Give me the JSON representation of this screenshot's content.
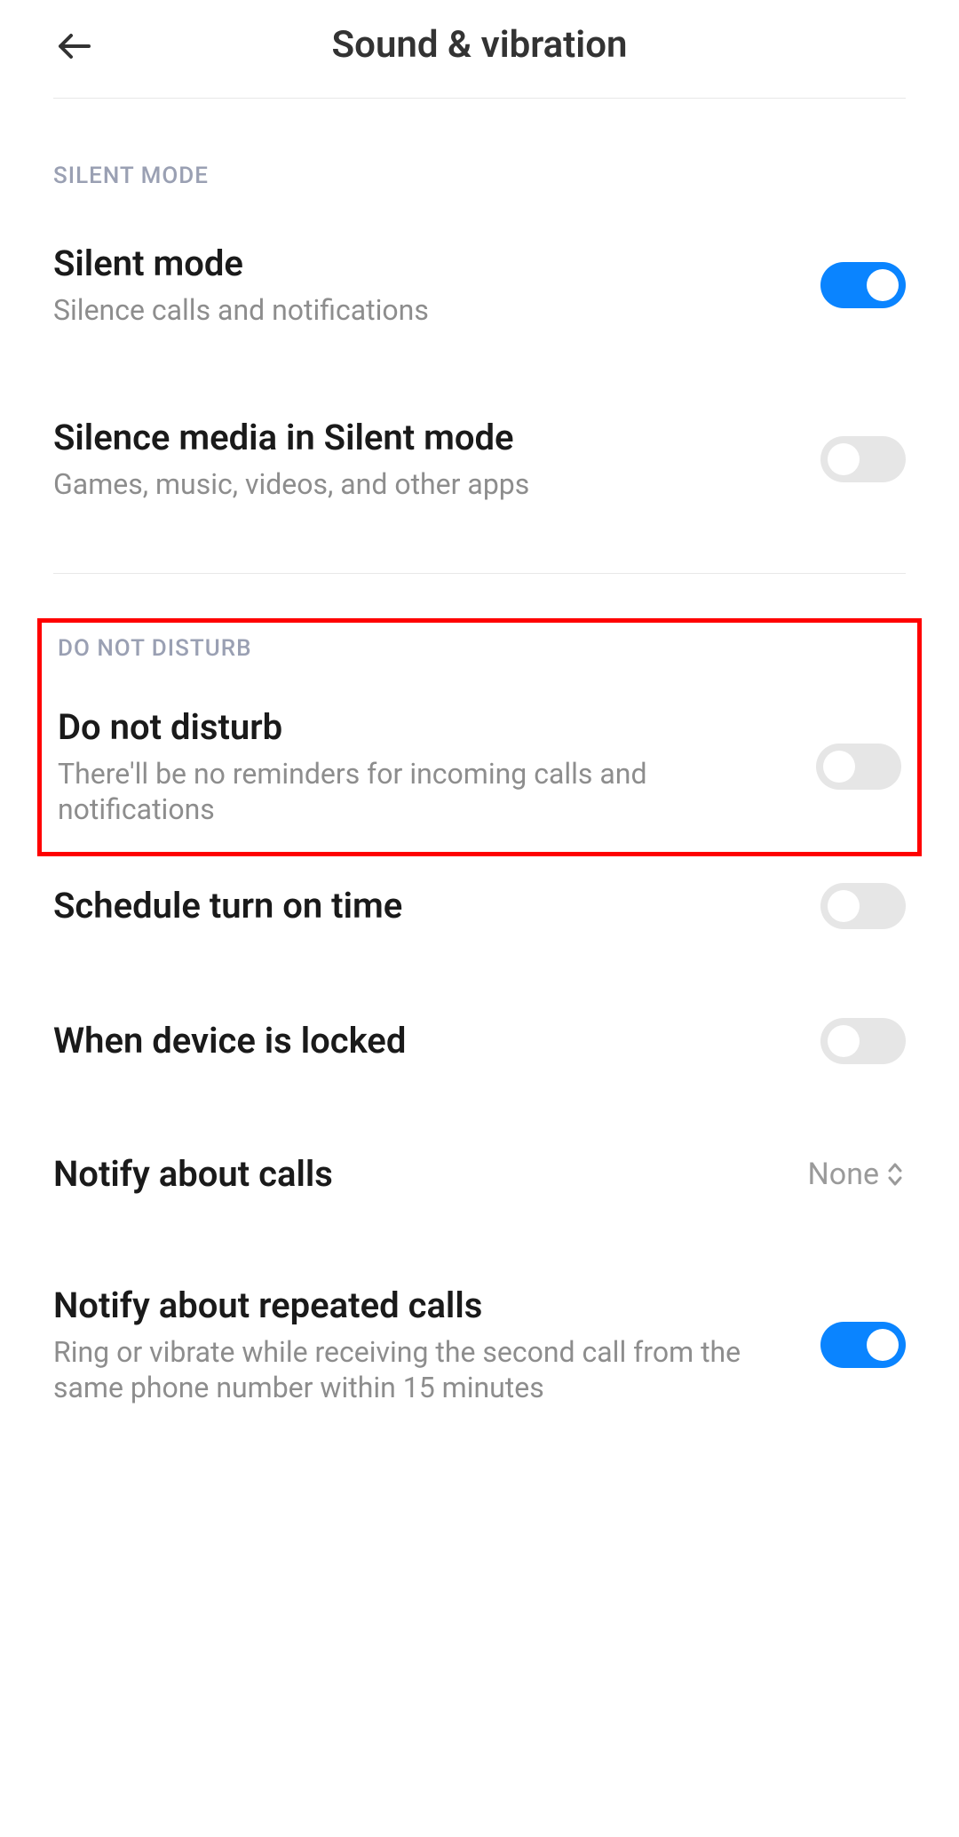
{
  "header": {
    "title": "Sound & vibration"
  },
  "sections": {
    "silent": {
      "label": "SILENT MODE",
      "silent_mode": {
        "title": "Silent mode",
        "sub": "Silence calls and notifications",
        "on": true
      },
      "silence_media": {
        "title": "Silence media in Silent mode",
        "sub": "Games, music, videos, and other apps",
        "on": false
      }
    },
    "dnd": {
      "label": "DO NOT DISTURB",
      "do_not_disturb": {
        "title": "Do not disturb",
        "sub": "There'll be no reminders for incoming calls and notifications",
        "on": false
      },
      "schedule": {
        "title": "Schedule turn on time",
        "on": false
      },
      "locked": {
        "title": "When device is locked",
        "on": false
      },
      "notify_calls": {
        "title": "Notify about calls",
        "value": "None"
      },
      "repeated": {
        "title": "Notify about repeated calls",
        "sub": "Ring or vibrate while receiving the second call from the same phone number within 15 minutes",
        "on": true
      }
    }
  }
}
